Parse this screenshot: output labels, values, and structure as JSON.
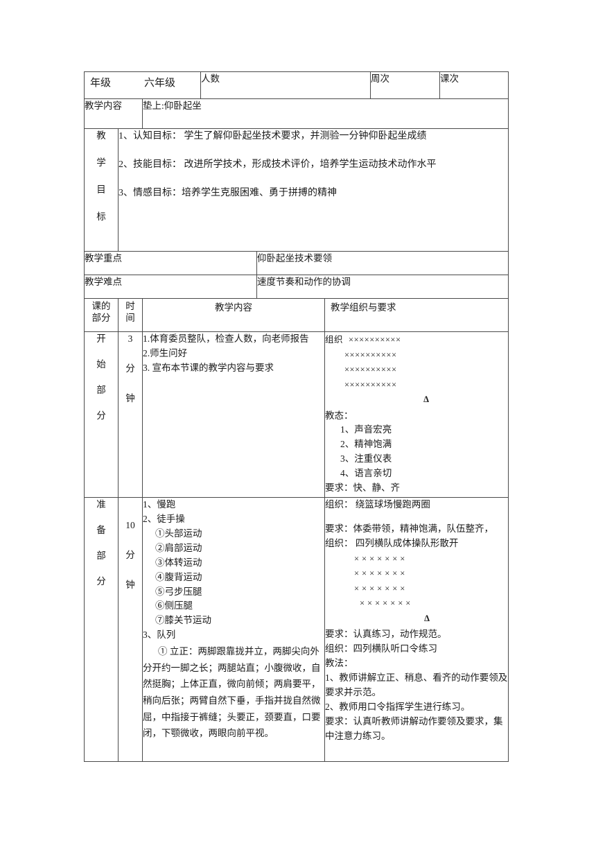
{
  "header": {
    "grade_label": "年级",
    "grade_value": "六年级",
    "count_label": "人数",
    "count_value": "",
    "week_label": "周次",
    "week_value": "",
    "period_label": "课次",
    "period_value": ""
  },
  "content_row": {
    "label": "教学内容",
    "value": "垫上:仰卧起坐"
  },
  "goals": {
    "label_chars": [
      "教",
      "学",
      "目",
      "标"
    ],
    "items": [
      "1、认知目标：  学生了解仰卧起坐技术要求，并测验一分钟仰卧起坐成绩",
      "2、技能目标：  改进所学技术，形成技术评价，培养学生运动技术动作水平",
      "3、情感目标：培养学生克服困难、勇于拼搏的精神"
    ]
  },
  "key_point": {
    "label": "教学重点",
    "value": "仰卧起坐技术要领"
  },
  "difficulty": {
    "label": "教学难点",
    "value": "速度节奏和动作的协调"
  },
  "columns": {
    "part_line1": "课的",
    "part_line2": "部分",
    "time_line1": "时",
    "time_line2": "间",
    "teaching_content": "教学内容",
    "organization": "教学组织与要求"
  },
  "sections": [
    {
      "name_chars": [
        "开",
        "始",
        "部",
        "分"
      ],
      "time_chars": [
        "3",
        "分",
        "钟"
      ],
      "content_lines": [
        "1.体育委员整队，检查人数，向老师报告",
        "2.师生问好",
        "3. 宣布本节课的教学内容与要求"
      ],
      "org": {
        "formation_label": "组织",
        "formation_rows": [
          "××××××××××",
          "××××××××××",
          "××××××××××",
          "××××××××××"
        ],
        "formation_marker": "Δ",
        "attitude_label": "教态：",
        "attitude_items": [
          "1、声音宏亮",
          "2、精神饱满",
          "3、注重仪表",
          "4、语言亲切"
        ],
        "requirement": "要求：快、静、齐"
      }
    },
    {
      "name_chars": [
        "准",
        "备",
        "部",
        "分"
      ],
      "time_chars": [
        "10",
        "分",
        "钟"
      ],
      "content_lines": [
        "1、慢跑",
        "2、徒手操"
      ],
      "exercises": [
        "①头部运动",
        "②肩部运动",
        "③体转运动",
        "④腹背运动",
        "⑤弓步压腿",
        "⑥侧压腿",
        "⑦膝关节运动"
      ],
      "drill_heading": "3、队列",
      "drill_paragraph": "①  立正：两脚跟靠拢并立，两脚尖向外分开约一脚之长；两腿站直；小腹微收，自然挺胸；上体正直，微向前倾；两肩要平，稍向后张；两臂自然下垂，手指并拢自然微屈，中指接于裤缝；头要正，颈要直，口要闭，下颚微收，两眼向前平视。",
      "org2": {
        "org_label_1": "组织：   绕篮球场慢跑两圈",
        "requirement_1": "要求：体委带领，精神饱满，队伍整齐，",
        "org_label_2": "组织：  四列横队成体操队形散开",
        "formation_rows": [
          "×××××××",
          "×××××××",
          "×××××××",
          "×××××××"
        ],
        "formation_marker": "Δ",
        "requirement_2": "要求：认真练习，动作规范。",
        "org_label_3": "组织：四列横队听口令练习",
        "method_label": "教法：",
        "method_items": [
          "1、教师讲解立正、稍息、看齐的动作要领及要求并示范。",
          "2、教师用口令指挥学生进行练习。"
        ],
        "requirement_3": "要求：认真听教师讲解动作要领及要求，集中注意力练习。"
      }
    }
  ]
}
